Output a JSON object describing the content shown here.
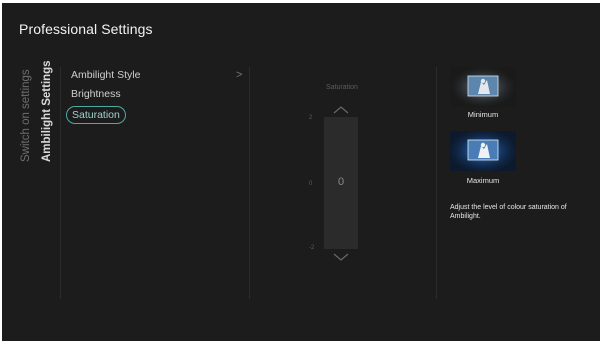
{
  "header": {
    "title": "Professional Settings"
  },
  "tabs": {
    "switch_on": "Switch on settings",
    "ambilight": "Ambilight Settings"
  },
  "menu": {
    "items": [
      "Ambilight Style",
      "Brightness",
      "Saturation"
    ],
    "selected_index": 2
  },
  "slider": {
    "title": "Saturation",
    "value": "0",
    "ticks": [
      "2",
      "0",
      "-2"
    ],
    "max": 2,
    "min": -2
  },
  "preview": {
    "minimum_label": "Minimum",
    "maximum_label": "Maximum",
    "description": "Adjust the level of colour saturation of Ambilight."
  },
  "colors": {
    "background": "#1c1c1c",
    "accent": "#4fa9a3",
    "glow": "#1f6fd6"
  }
}
